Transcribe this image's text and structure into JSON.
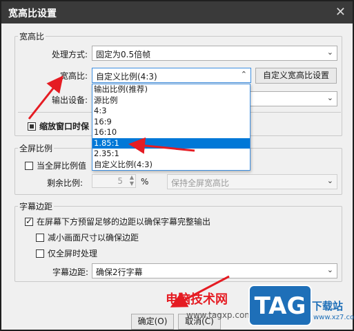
{
  "window": {
    "title": "宽高比设置",
    "close_glyph": "✕"
  },
  "aspect_group": {
    "label": "宽高比",
    "processing_label": "处理方式:",
    "processing_value": "固定为0.5倍帧",
    "aspect_label": "宽高比:",
    "aspect_value": "自定义比例(4:3)",
    "custom_button": "自定义宽高比设置",
    "output_label": "输出设备:",
    "zoom_check": "缩放窗口时保",
    "dropdown_options": [
      "输出比例(推荐)",
      "源比例",
      "4:3",
      "16:9",
      "16:10",
      "1.85:1",
      "2.35:1",
      "自定义比例(4:3)"
    ],
    "selected_option": "1.85:1"
  },
  "fullscreen_group": {
    "label": "全屏比例",
    "check_label": "当全屏比例值",
    "remaining_label": "剩余比例:",
    "remaining_value": "5",
    "percent": "%",
    "keep_value": "保持全屏宽高比"
  },
  "subtitle_group": {
    "label": "字幕边距",
    "reserve_check": "在屏幕下方预留足够的边距以确保字幕完整输出",
    "reduce_check": "减小画面尺寸以确保边距",
    "fullscreen_only_check": "仅全屏时处理",
    "margin_label": "字幕边距:",
    "margin_value": "确保2行字幕"
  },
  "footer": {
    "ok": "确定(O)",
    "cancel": "取消(C)"
  },
  "watermark": {
    "text": "电脑技术网",
    "url": "www.tagxp.com",
    "logo": "TAG",
    "side": "下载站",
    "side_url": "www.xz7.com"
  },
  "colors": {
    "annotation_arrow": "#e51c23",
    "selection": "#0078d7",
    "titlebar": "#3a3a3a"
  }
}
